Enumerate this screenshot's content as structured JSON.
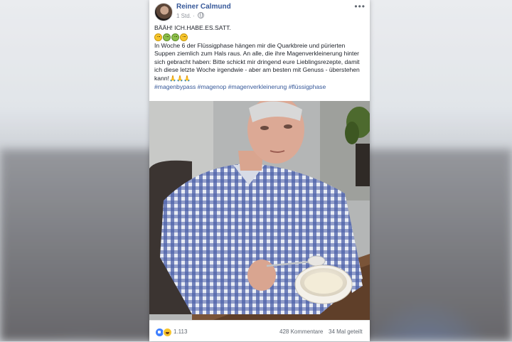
{
  "post": {
    "author": "Reiner Calmund",
    "timestamp": "1 Std.",
    "headline": "BÄÄH! ICH.HABE.ES.SATT.",
    "body": "In Woche 6 der Flüssigphase hängen mir die Quarkbreie und pürierten Suppen ziemlich zum Hals raus. An alle, die ihre Magenverkleinerung hinter sich gebracht haben: Bitte schickt mir dringend eure Lieblingsrezepte, damit ich diese letzte Woche irgendwie - aber am besten mit Genuss - überstehen kann!",
    "hashtags": "#magenbypass #magenop #magenverkleinerung #flüssigphase",
    "reaction_count": "1.113",
    "comments": "428 Kommentare",
    "shares": "34 Mal geteilt",
    "emojis": [
      "grinning-emoji",
      "nauseated-emoji",
      "nauseated-emoji",
      "grinning-emoji"
    ],
    "accent_color": "#365899"
  }
}
